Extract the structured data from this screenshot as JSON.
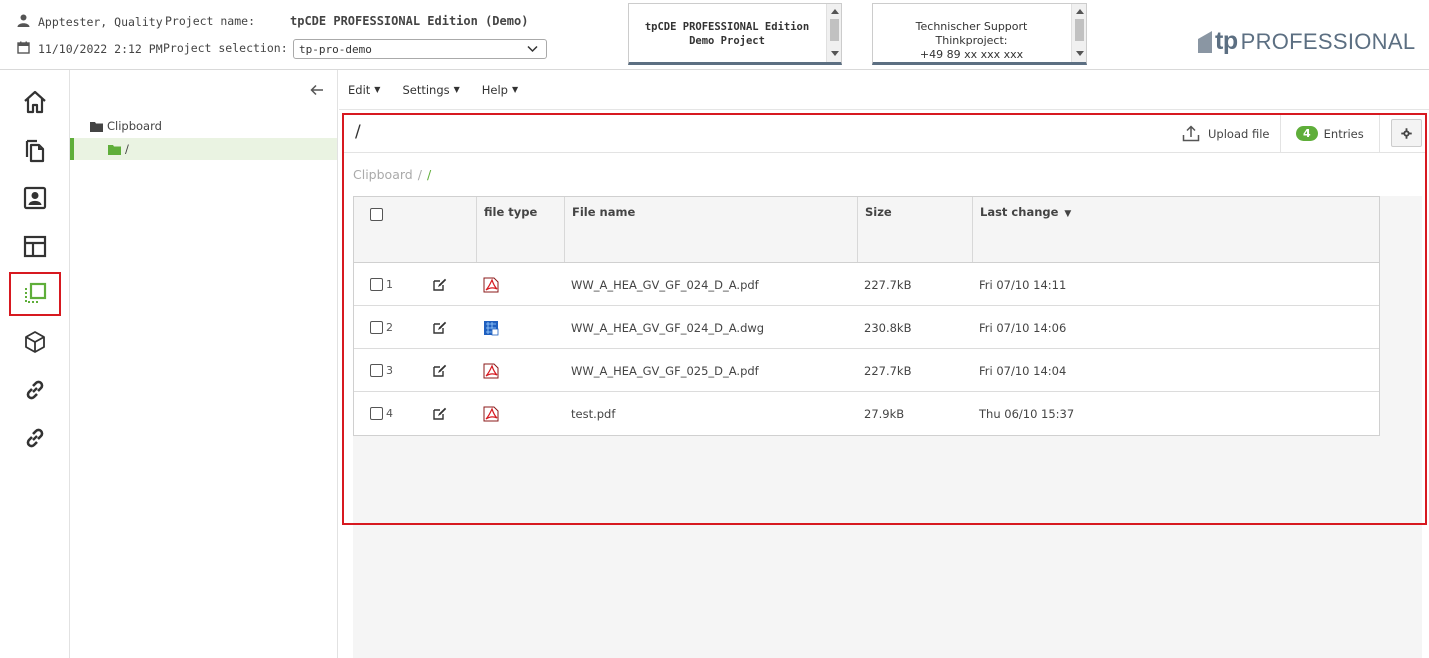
{
  "header": {
    "user": "Apptester, Quality",
    "datetime": "11/10/2022 2:12 PM",
    "project_name_label": "Project name:",
    "project_name_value": "tpCDE PROFESSIONAL Edition (Demo)",
    "project_selection_label": "Project selection:",
    "project_selection_value": "tp-pro-demo",
    "info_box_1": [
      "tpCDE PROFESSIONAL Edition",
      "Demo Project"
    ],
    "info_box_2": [
      "Technischer Support",
      "Thinkproject:",
      "+49 89 xx xxx xxx"
    ],
    "logo_tp": "tp",
    "logo_professional": "PROFESSIONAL"
  },
  "rail": {
    "icons": [
      "home-icon",
      "documents-icon",
      "contacts-icon",
      "table-layout-icon",
      "clipboard-icon",
      "cube-icon",
      "link-icon",
      "link-icon-2"
    ],
    "active": "clipboard-icon"
  },
  "tree": {
    "root_label": "Clipboard",
    "selected_label": "/"
  },
  "menu": {
    "items": [
      "Edit",
      "Settings",
      "Help"
    ]
  },
  "panel": {
    "path": "/",
    "upload_label": "Upload file",
    "entries_count": "4",
    "entries_label": "Entries",
    "breadcrumb": [
      "Clipboard",
      "/",
      "/"
    ]
  },
  "table": {
    "columns": [
      "file type",
      "File name",
      "Size",
      "Last change"
    ],
    "sort_indicator": "▼",
    "rows": [
      {
        "num": "1",
        "type": "pdf",
        "name": "WW_A_HEA_GV_GF_024_D_A.pdf",
        "size": "227.7kB",
        "changed": "Fri 07/10 14:11"
      },
      {
        "num": "2",
        "type": "dwg",
        "name": "WW_A_HEA_GV_GF_024_D_A.dwg",
        "size": "230.8kB",
        "changed": "Fri 07/10 14:06"
      },
      {
        "num": "3",
        "type": "pdf",
        "name": "WW_A_HEA_GV_GF_025_D_A.pdf",
        "size": "227.7kB",
        "changed": "Fri 07/10 14:04"
      },
      {
        "num": "4",
        "type": "pdf",
        "name": "test.pdf",
        "size": "27.9kB",
        "changed": "Thu 06/10 15:37"
      }
    ]
  },
  "colors": {
    "accent_green": "#5fae3a",
    "highlight_red": "#d71920",
    "brand_slate": "#5c6f82"
  }
}
